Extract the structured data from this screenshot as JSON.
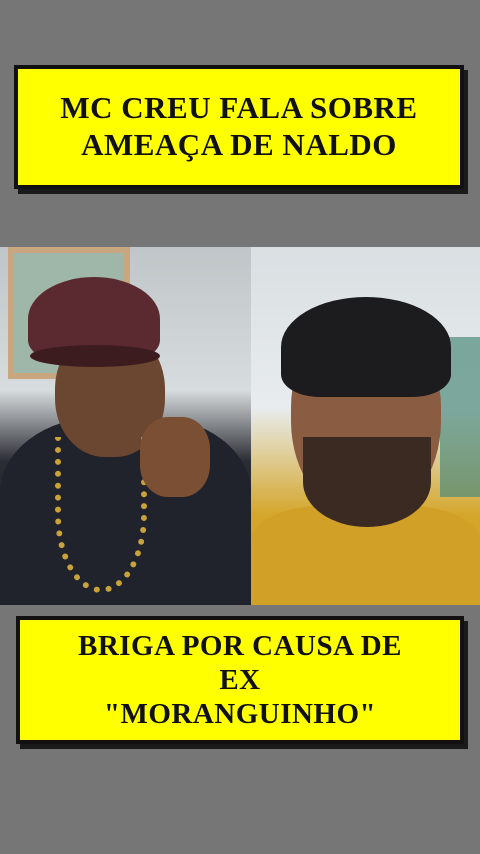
{
  "top_banner": {
    "lines": [
      "MC CREU FALA SOBRE",
      "AMEAÇA DE NALDO"
    ]
  },
  "bottom_banner": {
    "lines": [
      "BRIGA POR CAUSA DE",
      "EX",
      "\"MORANGUINHO\""
    ]
  },
  "colors": {
    "background": "#767676",
    "banner": "#ffff00",
    "banner_text": "#111111"
  }
}
